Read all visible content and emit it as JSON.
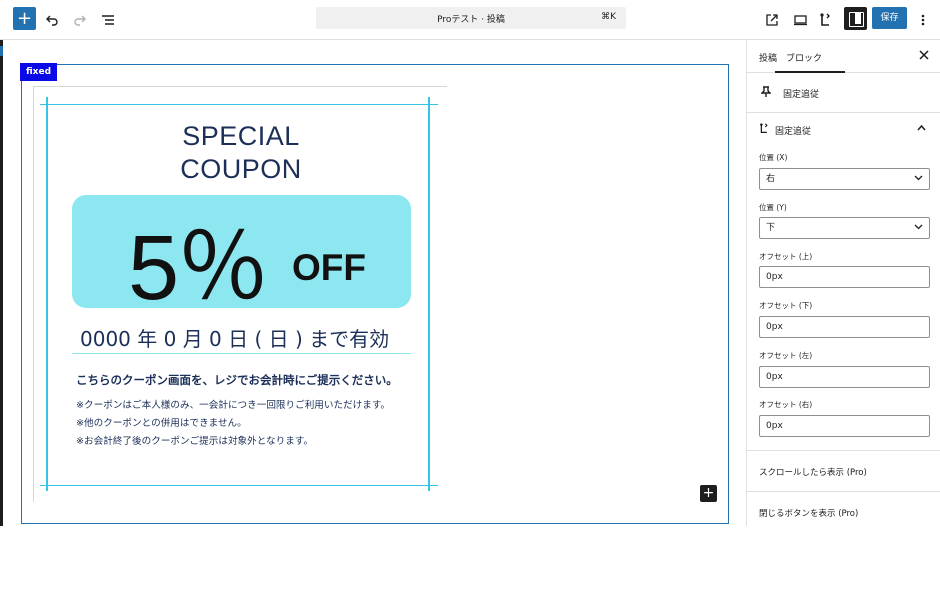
{
  "toolbar": {
    "inserter_label": "+",
    "command_text": "Proテスト · 投稿",
    "command_shortcut": "⌘K",
    "save_label": "保存",
    "icons": [
      "undo-icon",
      "redo-icon",
      "list-view-icon",
      "external-link-icon",
      "desktop-preview-icon",
      "fixed-block-icon",
      "settings-sidebar-icon",
      "more-options-icon"
    ]
  },
  "canvas": {
    "fixed_tag": "fixed",
    "coupon": {
      "title_line1": "SPECIAL",
      "title_line2": "COUPON",
      "percent": "5％",
      "off": "OFF",
      "date": "0000 年 0 月 0 日 ( 日 ) まで有効",
      "lead": "こちらのクーポン画面を、レジでお会計時にご提示ください。",
      "notes": [
        "※クーポンはご本人様のみ、一会計につき一回限りご利用いただけます。",
        "※他のクーポンとの併用はできません。",
        "※お会計終了後のクーポンご提示は対象外となります。"
      ],
      "colors": {
        "accent": "#8de7f1",
        "text": "#1b2f58",
        "guide": "#35c5e3"
      }
    },
    "add_block_label": "+"
  },
  "sidebar": {
    "tabs": [
      "投稿",
      "ブロック"
    ],
    "active_tab": "ブロック",
    "block_name": "固定追従",
    "panel_title": "固定追従",
    "fields": {
      "pos_x_label": "位置 (X)",
      "pos_x_value": "右",
      "pos_y_label": "位置 (Y)",
      "pos_y_value": "下",
      "offset_top_label": "オフセット (上)",
      "offset_top_value": "0px",
      "offset_bottom_label": "オフセット (下)",
      "offset_bottom_value": "0px",
      "offset_left_label": "オフセット (左)",
      "offset_left_value": "0px",
      "offset_right_label": "オフセット (右)",
      "offset_right_value": "0px"
    },
    "scroll_show": "スクロールしたら表示 (Pro)",
    "close_button_show": "閉じるボタンを表示 (Pro)"
  }
}
